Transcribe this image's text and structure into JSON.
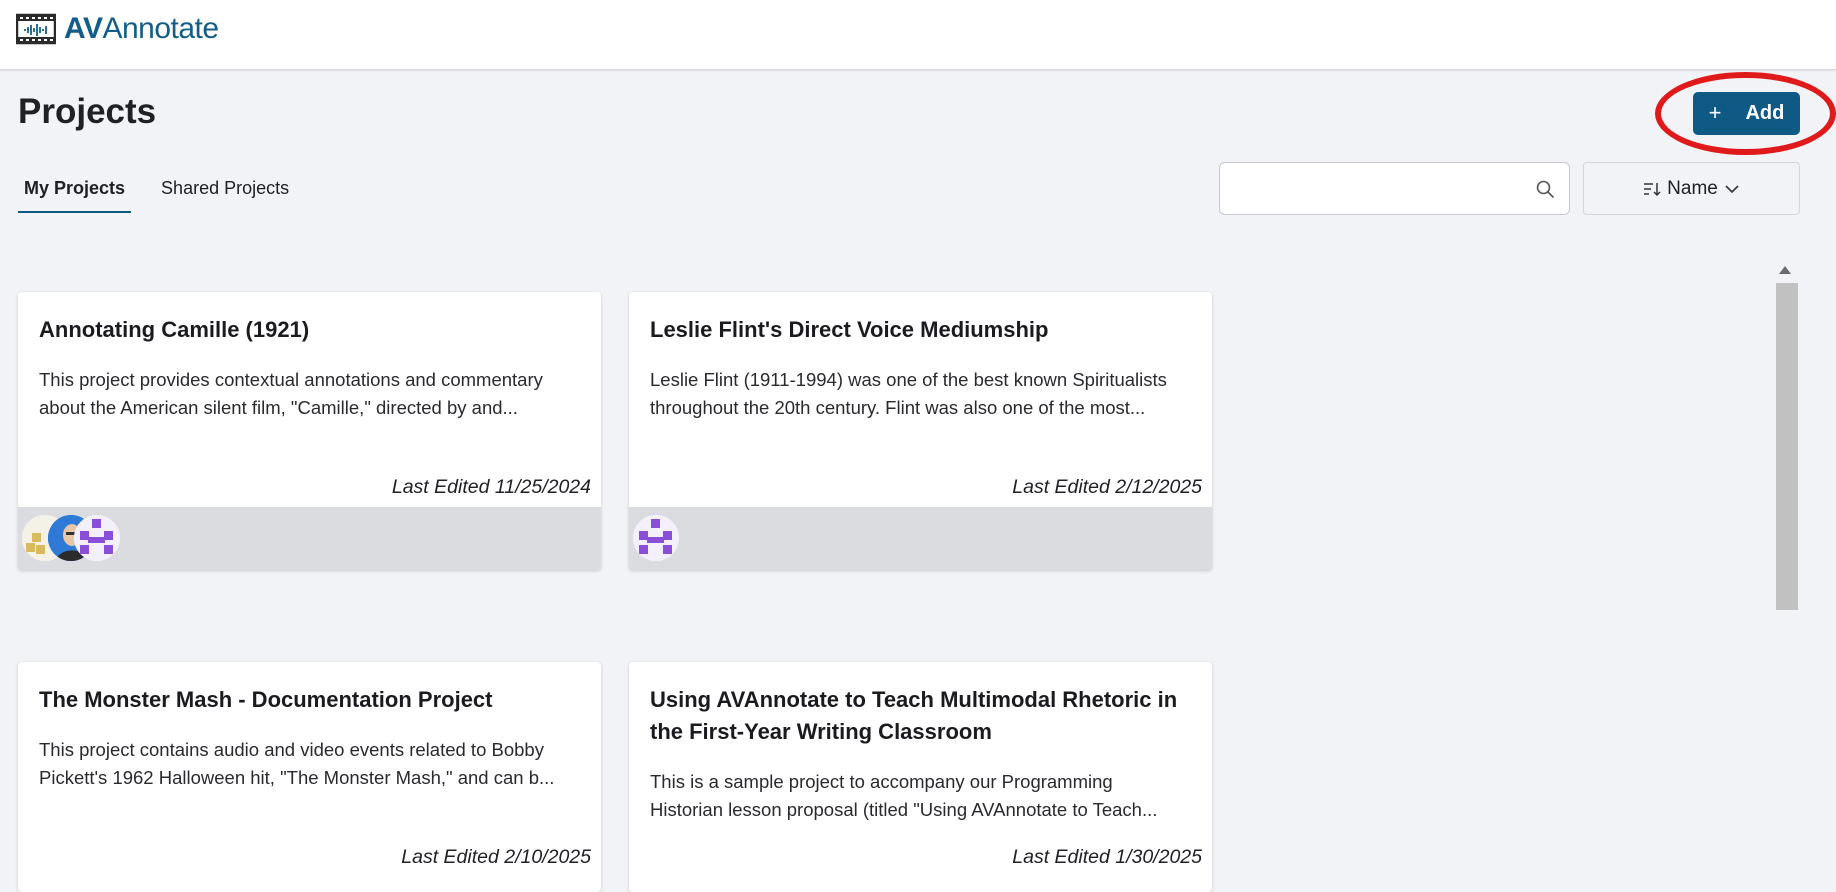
{
  "app": {
    "brand_bold": "AV",
    "brand_rest": "Annotate"
  },
  "header": {
    "page_title": "Projects",
    "add_label": "Add"
  },
  "tabs": [
    {
      "label": "My Projects",
      "active": true
    },
    {
      "label": "Shared Projects",
      "active": false
    }
  ],
  "search": {
    "value": "",
    "placeholder": ""
  },
  "sort": {
    "label": "Name"
  },
  "projects": [
    {
      "title": "Annotating Camille (1921)",
      "desc_line1": "This project provides contextual annotations and commentary",
      "desc_line2": "about the American silent film, \"Camille,\" directed by and...",
      "last_edited": "Last Edited 11/25/2024"
    },
    {
      "title": "Leslie Flint's Direct Voice Mediumship",
      "desc_line1": "Leslie Flint (1911-1994) was one of the best known Spiritualists",
      "desc_line2": "throughout the 20th century. Flint was also one of the most...",
      "last_edited": "Last Edited 2/12/2025"
    },
    {
      "title": "The Monster Mash - Documentation Project",
      "desc_line1": "This project contains audio and video events related to Bobby",
      "desc_line2": "Pickett's 1962 Halloween hit, \"The Monster Mash,\" and can b...",
      "last_edited": "Last Edited 2/10/2025"
    },
    {
      "title": "Using AVAnnotate to Teach Multimodal Rhetoric in the First-Year Writing Classroom",
      "desc_line1": "This is a sample project to accompany our Programming",
      "desc_line2": "Historian lesson proposal (titled \"Using AVAnnotate to Teach...",
      "last_edited": "Last Edited 1/30/2025"
    }
  ],
  "colors": {
    "brand": "#125e88",
    "primary_button": "#0f5a85",
    "highlight_ring": "#e01a1a",
    "card_footer": "#dadce0"
  }
}
